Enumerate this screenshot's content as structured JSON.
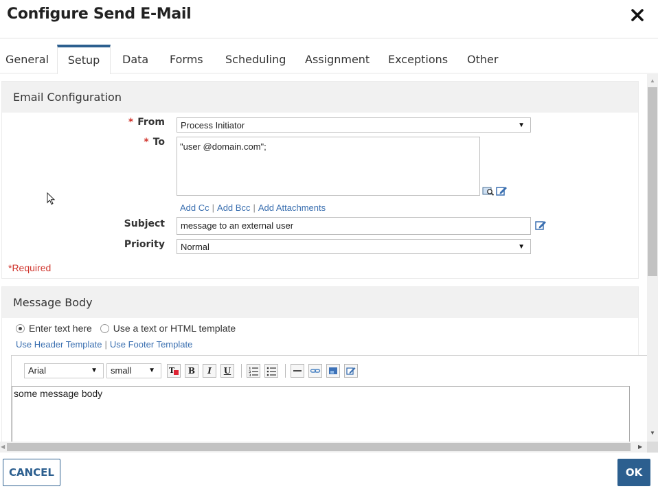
{
  "dialog": {
    "title": "Configure Send E-Mail"
  },
  "tabs": [
    {
      "label": "General",
      "active": false
    },
    {
      "label": "Setup",
      "active": true
    },
    {
      "label": "Data",
      "active": false
    },
    {
      "label": "Forms",
      "active": false
    },
    {
      "label": "Scheduling",
      "active": false
    },
    {
      "label": "Assignment",
      "active": false
    },
    {
      "label": "Exceptions",
      "active": false
    },
    {
      "label": "Other",
      "active": false
    }
  ],
  "email_config": {
    "heading": "Email Configuration",
    "required_marker": "*",
    "from_label": "From",
    "from_value": "Process Initiator",
    "to_label": "To",
    "to_value": "\"user @domain.com\";",
    "add_cc": "Add Cc",
    "add_bcc": "Add Bcc",
    "add_attachments": "Add Attachments",
    "link_separator": "|",
    "subject_label": "Subject",
    "subject_value": "message to an external user",
    "priority_label": "Priority",
    "priority_value": "Normal",
    "required_note": "*Required"
  },
  "message_body": {
    "heading": "Message Body",
    "option_enter_text": "Enter text here",
    "option_template": "Use a text or HTML template",
    "selected_option": "Enter text here",
    "header_template_link": "Use Header Template",
    "footer_template_link": "Use Footer Template",
    "font_value": "Arial",
    "size_value": "small",
    "bold_glyph": "B",
    "italic_glyph": "I",
    "underline_glyph": "U",
    "body_text": "some message body"
  },
  "footer": {
    "cancel_label": "CANCEL",
    "ok_label": "OK"
  },
  "colors": {
    "accent": "#2c5f8f",
    "required": "#d0342c",
    "link": "#3a6fb0"
  }
}
